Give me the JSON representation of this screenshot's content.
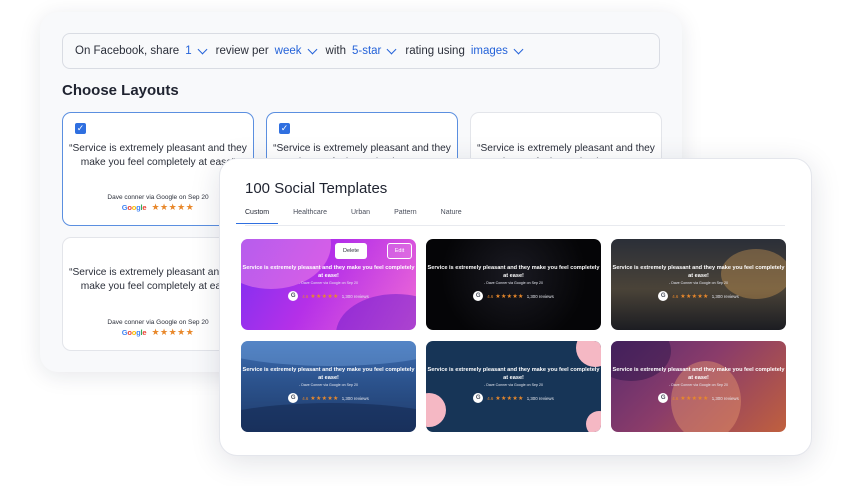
{
  "rule_bar": {
    "prefix": "On Facebook, share",
    "count": "1",
    "review_per": "review per",
    "period": "week",
    "with_label": "with",
    "rating": "5-star",
    "rating_using": "rating using",
    "media": "images"
  },
  "layouts": {
    "title": "Choose Layouts",
    "quote": "“Service is extremely pleasant and they make you feel completely at ease”",
    "attribution_1": "Dave conner via Google on Sep 20",
    "attribution_2": "Dave conner via Google on Sep 20",
    "google": "Google",
    "stars": "★★★★★"
  },
  "templates": {
    "title": "100 Social Templates",
    "tabs": [
      "Custom",
      "Healthcare",
      "Urban",
      "Pattern",
      "Nature"
    ],
    "active_tab": "Custom",
    "quote": "Service is extremely pleasant and they make you feel completely at ease!",
    "attribution": "- Dave Conner via Google on Sep 20",
    "g": "G",
    "rating": "4.6",
    "stars": "★★★★★",
    "reviews": "1,300 reviews",
    "delete_label": "Delete",
    "edit_label": "Edit"
  },
  "colors": {
    "accent": "#2563d9",
    "star": "#e8882b"
  }
}
